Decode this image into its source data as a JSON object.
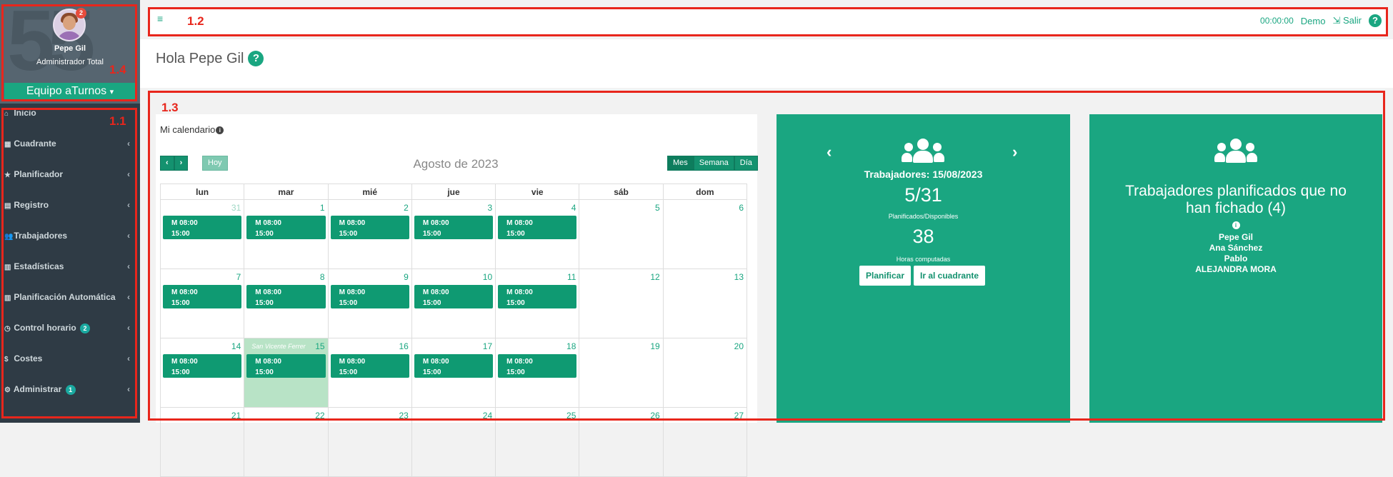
{
  "profile": {
    "name": "Pepe Gil",
    "role": "Administrador Total",
    "notification_count": "2",
    "team": "Equipo aTurnos",
    "team_caret": "▾",
    "bg_text": "55"
  },
  "menu": [
    {
      "label": "Inicio",
      "icon": "home-icon",
      "glyph": "⌂",
      "chevron": ""
    },
    {
      "label": "Cuadrante",
      "icon": "grid-icon",
      "glyph": "▦",
      "chevron": "‹"
    },
    {
      "label": "Planificador",
      "icon": "star-icon",
      "glyph": "★",
      "chevron": "‹"
    },
    {
      "label": "Registro",
      "icon": "file-icon",
      "glyph": "▤",
      "chevron": "‹"
    },
    {
      "label": "Trabajadores",
      "icon": "users-icon",
      "glyph": "👥",
      "chevron": "‹"
    },
    {
      "label": "Estadísticas",
      "icon": "bar-chart-icon",
      "glyph": "▥",
      "chevron": "‹"
    },
    {
      "label": "Planificación Automática",
      "icon": "area-chart-icon",
      "glyph": "▥",
      "chevron": "‹"
    },
    {
      "label": "Control horario",
      "icon": "clock-icon",
      "glyph": "◷",
      "badge": "2",
      "chevron": "‹"
    },
    {
      "label": "Costes",
      "icon": "dollar-icon",
      "glyph": "$",
      "chevron": "‹"
    },
    {
      "label": "Administrar",
      "icon": "gear-icon",
      "glyph": "⚙",
      "badge": "1",
      "chevron": "‹"
    }
  ],
  "annotations": {
    "sidebar": "1.1",
    "topbar": "1.2",
    "content": "1.3",
    "profile": "1.4"
  },
  "topbar": {
    "menu_glyph": "≡",
    "timer": "00:00:00",
    "user": "Demo",
    "logout": "Salir",
    "logout_glyph": "⇲",
    "help": "?"
  },
  "header": {
    "greeting": "Hola Pepe Gil",
    "help": "?"
  },
  "calendar": {
    "title": "Mi calendario",
    "info_glyph": "i",
    "prev": "‹",
    "next": "›",
    "today": "Hoy",
    "month_label": "Agosto de 2023",
    "views": [
      "Mes",
      "Semana",
      "Día"
    ],
    "weekdays": [
      "lun",
      "mar",
      "mié",
      "jue",
      "vie",
      "sáb",
      "dom"
    ],
    "weeks": [
      [
        "31",
        "1",
        "2",
        "3",
        "4",
        "5",
        "6"
      ],
      [
        "7",
        "8",
        "9",
        "10",
        "11",
        "12",
        "13"
      ],
      [
        "14",
        "15",
        "16",
        "17",
        "18",
        "19",
        "20"
      ],
      [
        "21",
        "22",
        "23",
        "24",
        "25",
        "26",
        "27"
      ]
    ],
    "holiday_label": "San Vicente Ferrer",
    "event_line1": "M 08:00",
    "event_line2": "15:00"
  },
  "workers_card": {
    "prev": "‹",
    "next": "›",
    "title": "Trabajadores: 15/08/2023",
    "ratio": "5/31",
    "ratio_label": "Planificados/Disponibles",
    "hours": "38",
    "hours_label": "Horas computadas",
    "plan_button": "Planificar",
    "grid_button": "Ir al cuadrante"
  },
  "pending_card": {
    "title": "Trabajadores planificados que no han fichado (4)",
    "info_glyph": "i",
    "names": [
      "Pepe Gil",
      "Ana Sánchez",
      "Pablo",
      "ALEJANDRA MORA"
    ]
  },
  "colors": {
    "accent": "#1aa681",
    "sidebar": "#2f3b45",
    "annotation": "#e8261c"
  }
}
